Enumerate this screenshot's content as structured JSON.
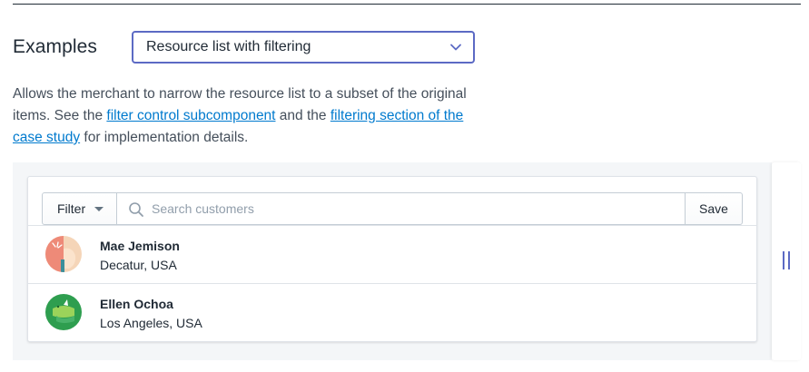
{
  "section": {
    "heading": "Examples",
    "example_select": {
      "selected": "Resource list with filtering"
    }
  },
  "description": {
    "part1": "Allows the merchant to narrow the resource list to a subset of the original items. See the ",
    "link1": "filter control subcomponent",
    "part2": " and the ",
    "link2": "filtering section of the case study",
    "part3": " for implementation details."
  },
  "filter_bar": {
    "filter_label": "Filter",
    "search_placeholder": "Search customers",
    "save_label": "Save"
  },
  "customers": [
    {
      "name": "Mae Jemison",
      "location": "Decatur, USA",
      "avatar_icon": "avatar-illustration-orange"
    },
    {
      "name": "Ellen Ochoa",
      "location": "Los Angeles, USA",
      "avatar_icon": "avatar-illustration-green"
    }
  ],
  "colors": {
    "accent": "#5c6ac4",
    "link": "#007ace",
    "frame_bg": "#f4f6f8"
  }
}
